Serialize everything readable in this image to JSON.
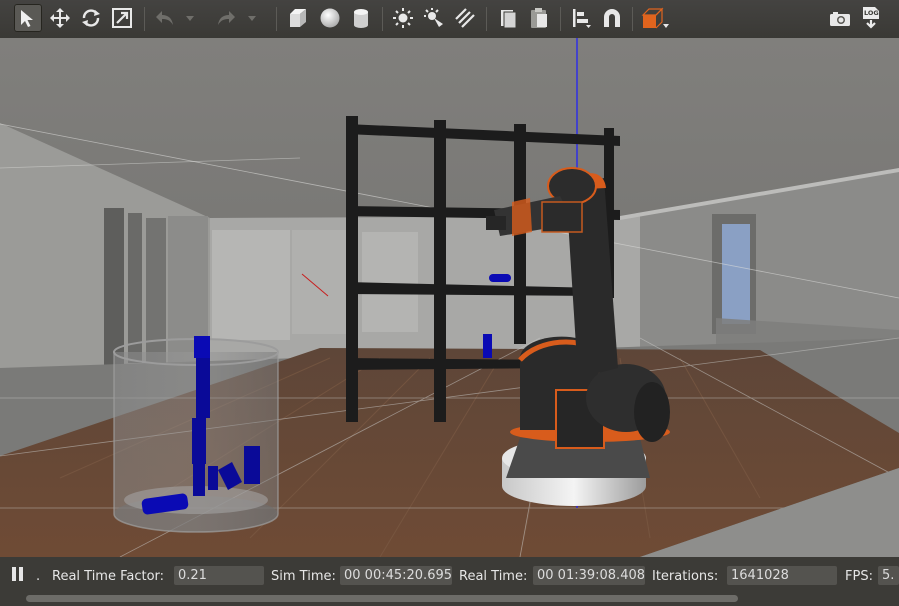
{
  "toolbar": {
    "tools": [
      {
        "name": "select-mode-icon",
        "active": true
      },
      {
        "name": "translate-mode-icon"
      },
      {
        "name": "rotate-mode-icon"
      },
      {
        "name": "scale-mode-icon"
      },
      {
        "name": "undo-icon"
      },
      {
        "name": "undo-history-dropdown-icon"
      },
      {
        "name": "redo-icon"
      },
      {
        "name": "redo-history-dropdown-icon"
      },
      {
        "name": "box-shape-icon"
      },
      {
        "name": "sphere-shape-icon"
      },
      {
        "name": "cylinder-shape-icon"
      },
      {
        "name": "point-light-icon"
      },
      {
        "name": "spot-light-icon"
      },
      {
        "name": "directional-light-icon"
      },
      {
        "name": "copy-icon"
      },
      {
        "name": "paste-icon"
      },
      {
        "name": "align-icon"
      },
      {
        "name": "snap-magnet-icon"
      },
      {
        "name": "view-angle-icon"
      },
      {
        "name": "screenshot-camera-icon"
      },
      {
        "name": "log-icon"
      }
    ],
    "log_text": "LOG"
  },
  "status": {
    "pause_label": "Pause",
    "step_label": ".",
    "real_time_factor_label": "Real Time Factor:",
    "real_time_factor": "0.21",
    "sim_time_label": "Sim Time:",
    "sim_time": "00 00:45:20.695",
    "real_time_label": "Real Time:",
    "real_time": "00 01:39:08.408",
    "iterations_label": "Iterations:",
    "iterations": "1641028",
    "fps_label": "FPS:",
    "fps": "5."
  },
  "colors": {
    "toolbar_bg": "#3c3b37",
    "accent_orange": "#e0641e",
    "cylinder_blue": "#00008b",
    "shelf_black": "#1c1c1c",
    "floor_wood": "#6b4a36"
  }
}
